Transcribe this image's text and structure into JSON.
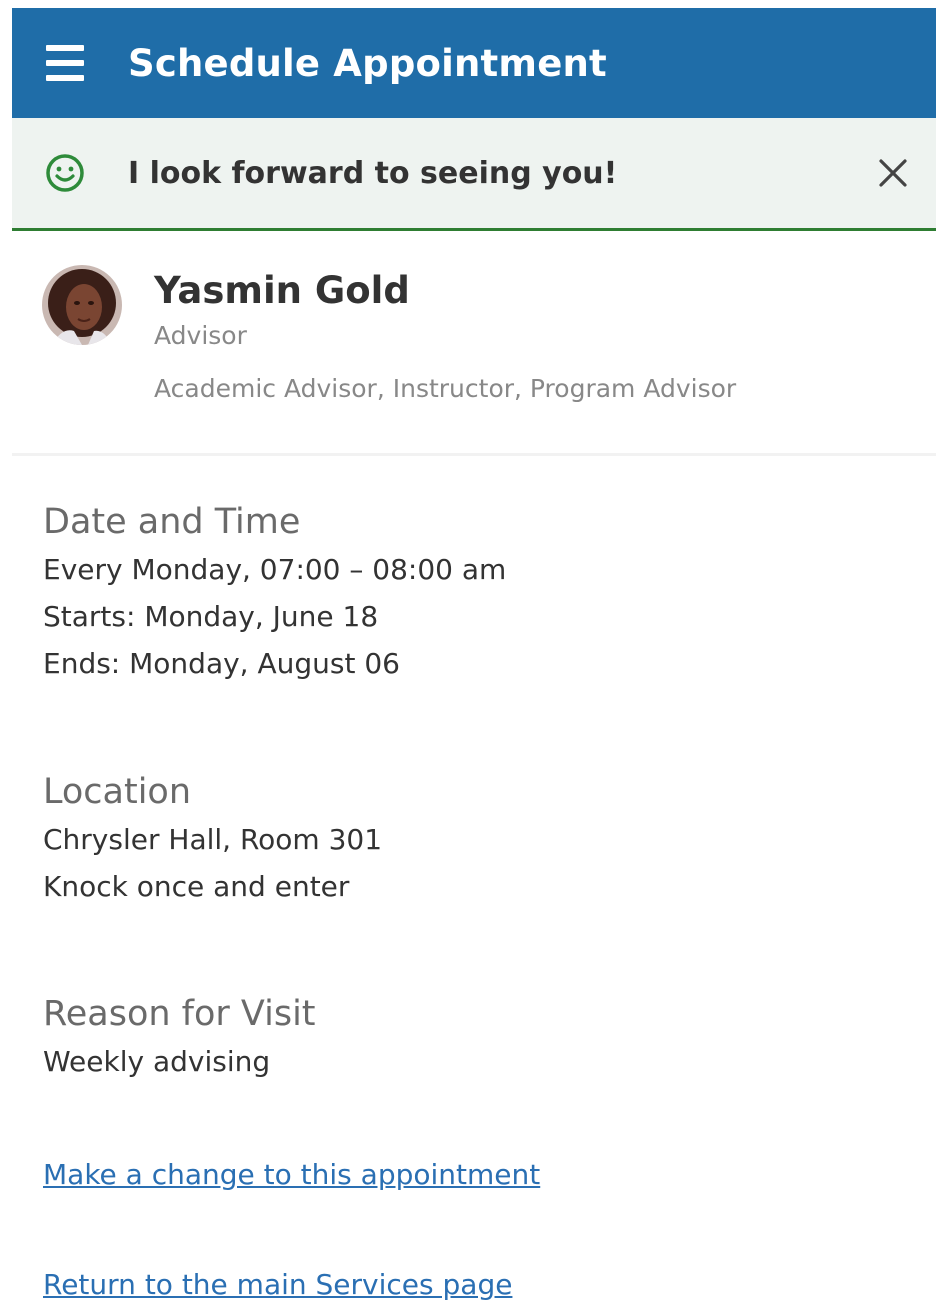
{
  "header": {
    "title": "Schedule Appointment",
    "menu_icon": "hamburger-menu-icon",
    "background": "#1f6da8"
  },
  "banner": {
    "message": "I look forward to seeing you!",
    "icon": "smile-icon",
    "close_icon": "close-icon",
    "accent": "#2e7d32"
  },
  "advisor": {
    "name": "Yasmin Gold",
    "role": "Advisor",
    "titles": "Academic Advisor, Instructor, Program Advisor"
  },
  "date_time": {
    "heading": "Date and Time",
    "lines": [
      "Every Monday, 07:00 – 08:00 am",
      "Starts: Monday, June 18",
      "Ends: Monday, August 06"
    ]
  },
  "location": {
    "heading": "Location",
    "lines": [
      "Chrysler Hall, Room 301",
      "Knock once and enter"
    ]
  },
  "reason": {
    "heading": "Reason for Visit",
    "lines": [
      "Weekly advising"
    ]
  },
  "links": {
    "change": "Make a change to this appointment",
    "return": "Return to the main Services page",
    "color": "#2a6fb3"
  }
}
